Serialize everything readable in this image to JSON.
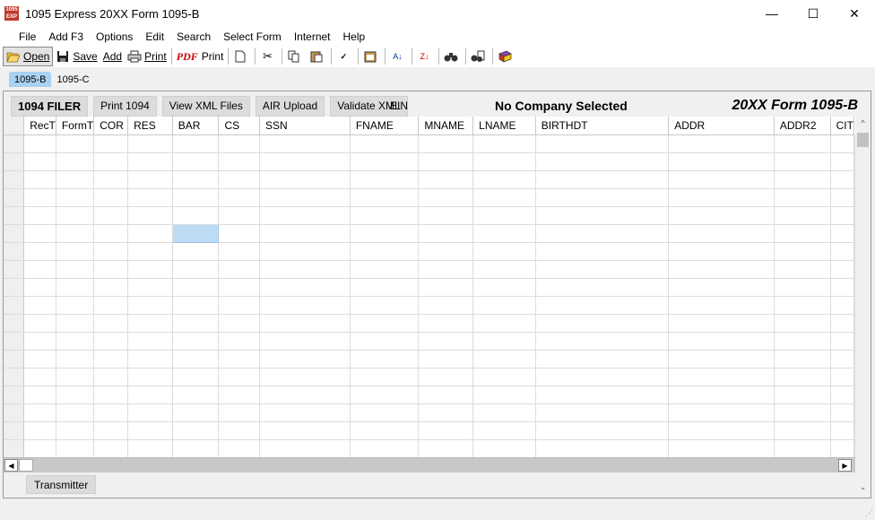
{
  "window": {
    "title": "1095 Express 20XX Form 1095-B",
    "icon_text": "1095 EXP",
    "minimize": "—",
    "maximize": "☐",
    "close": "✕"
  },
  "menu": [
    "File",
    "Add F3",
    "Options",
    "Edit",
    "Search",
    "Select Form",
    "Internet",
    "Help"
  ],
  "toolbar": {
    "open": "Open",
    "save": "Save",
    "add": "Add",
    "print": "Print",
    "pdf": "PDF",
    "pdf_print": "Print"
  },
  "tabs": [
    "1095-B",
    "1095-C"
  ],
  "header": {
    "filer_button": "1094 FILER",
    "print_button": "Print 1094",
    "xml_button": "View XML Files",
    "air_button": "AIR Upload",
    "validate_button": "Validate XML",
    "ein_label": "EIN",
    "company": "No Company Selected",
    "form_title": "20XX Form 1095-B"
  },
  "grid": {
    "columns": [
      "RecT",
      "FormT",
      "COR",
      "RES",
      "BAR",
      "CS",
      "SSN",
      "FNAME",
      "MNAME",
      "LNAME",
      "BIRTHDT",
      "ADDR",
      "ADDR2",
      "CIT"
    ],
    "row_count": 18,
    "selected": {
      "row": 5,
      "col": 4
    }
  },
  "footer": {
    "transmitter_button": "Transmitter"
  },
  "colors": {
    "selected_tab": "#a9d1f2",
    "selected_cell": "#bcdcf5",
    "pdf": "#cc0000"
  }
}
